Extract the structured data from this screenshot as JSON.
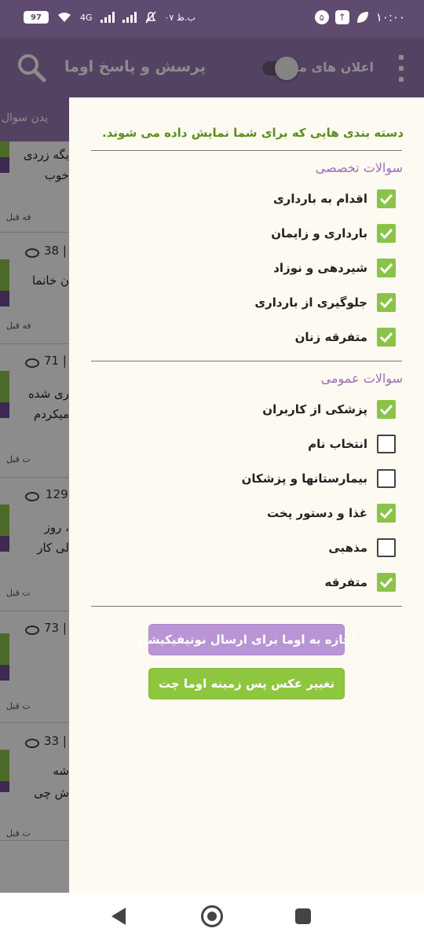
{
  "status_bar": {
    "time": "۱۰:۰۰",
    "badge_count": "۵",
    "battery": "97",
    "network": "4G",
    "small_time": "۰۷ ب.ظ"
  },
  "app_bar": {
    "title": "پرسش و پاسخ اوما",
    "notif_label": "اعلان های من",
    "notif_toggle_on": true
  },
  "background": {
    "tab_text": "یدن سوال",
    "cards": [
      {
        "text1": "یگه زردی",
        "text2": "خوب",
        "views": "",
        "time": "فه قبل"
      },
      {
        "text1": "ن خانما",
        "text2": "",
        "views": "38 |",
        "time": "فه قبل"
      },
      {
        "text1": "ری شده",
        "text2": "میکردم",
        "views": "71 |",
        "time": "ت قبل"
      },
      {
        "text1": "، روز",
        "text2": "لی کار",
        "views": "129",
        "time": "ت قبل"
      },
      {
        "text1": "",
        "text2": "",
        "views": "73 |",
        "time": "ت قبل"
      },
      {
        "text1": "شه",
        "text2": "ش چی",
        "views": "33 |",
        "time": "ت قبل"
      }
    ]
  },
  "drawer": {
    "heading": "دسته بندی هایی که برای شما نمایش داده می شوند.",
    "sections": [
      {
        "title": "سوالات تخصصی",
        "items": [
          {
            "label": "اقدام به بارداری",
            "checked": true
          },
          {
            "label": "بارداری و زایمان",
            "checked": true
          },
          {
            "label": "شیردهی و نوزاد",
            "checked": true
          },
          {
            "label": "جلوگیری از بارداری",
            "checked": true
          },
          {
            "label": "متفرقه زنان",
            "checked": true
          }
        ]
      },
      {
        "title": "سوالات عمومی",
        "items": [
          {
            "label": "پزشکی از کاربران",
            "checked": true
          },
          {
            "label": "انتخاب نام",
            "checked": false
          },
          {
            "label": "بیمارستانها و پزشکان",
            "checked": false
          },
          {
            "label": "غذا و دستور پخت",
            "checked": true
          },
          {
            "label": "مذهبی",
            "checked": false
          },
          {
            "label": "متفرقه",
            "checked": true
          }
        ]
      }
    ],
    "btn_notification": "اجازه به اوما برای ارسال نوتیفیکیشن",
    "btn_background": "تغییر عکس پس زمینه اوما چت"
  },
  "colors": {
    "status_bar": "#5f4a70",
    "app_bar": "#9a79b4",
    "accent_green": "#8bc34a",
    "heading_green": "#5a8f1c",
    "section_purple": "#9a6cb8",
    "drawer_bg": "#fdfaf1"
  },
  "icons": {
    "search": "search-icon",
    "menu": "more-vert-icon",
    "check": "check-icon",
    "nav_back": "back-triangle-icon",
    "nav_home": "home-circle-icon",
    "nav_recent": "recent-square-icon"
  }
}
